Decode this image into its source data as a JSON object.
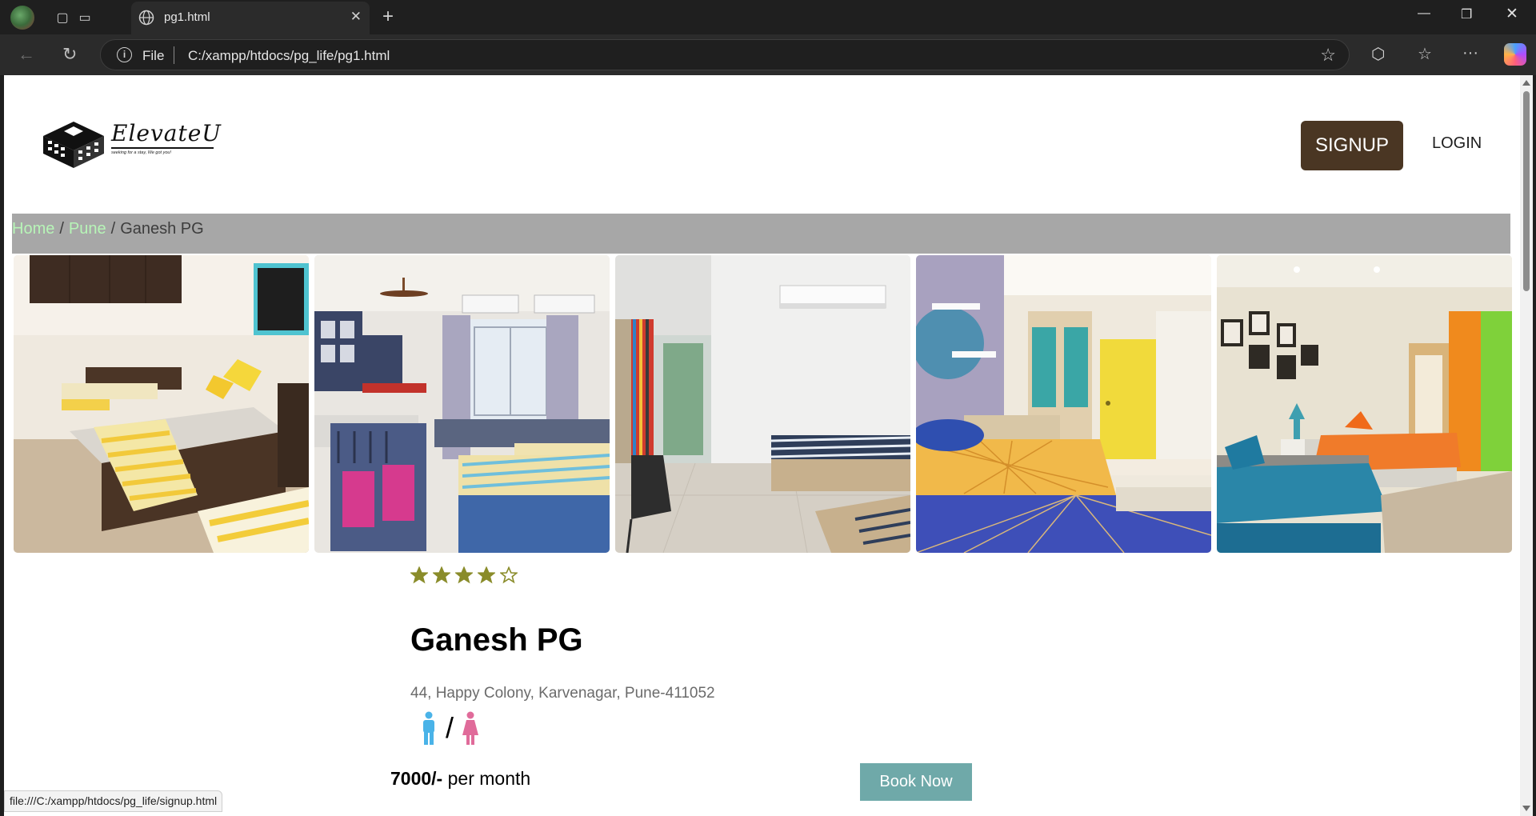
{
  "browser": {
    "tab_title": "pg1.html",
    "address_scheme": "File",
    "address_url": "C:/xampp/htdocs/pg_life/pg1.html",
    "status_url": "file:///C:/xampp/htdocs/pg_life/signup.html"
  },
  "header": {
    "brand": "ElevateU",
    "tagline": "seeking for a stay, We got you!",
    "signup_label": "SIGNUP",
    "login_label": "LOGIN"
  },
  "breadcrumb": {
    "home": "Home",
    "city": "Pune",
    "current": "Ganesh PG",
    "separator": "/"
  },
  "property": {
    "rating": 4,
    "rating_max": 5,
    "name": "Ganesh PG",
    "address": "44, Happy Colony, Karvenagar, Pune-411052",
    "gender_separator": "/",
    "rent_amount": "7000/-",
    "rent_period": "per month",
    "book_label": "Book Now"
  },
  "colors": {
    "signup_bg": "#4a3623",
    "breadcrumb_bg": "#a7a7a7",
    "breadcrumb_link": "#b7f5b7",
    "star": "#8a8c2a",
    "book_bg": "#6fa9a9",
    "male_icon": "#4ab3e8",
    "female_icon": "#e06b9a"
  },
  "icons": {
    "gender_male": "male-icon",
    "gender_female": "female-icon"
  },
  "gallery": {
    "photos": [
      "room-photo-1",
      "room-photo-2",
      "room-photo-3",
      "room-photo-4",
      "room-photo-5"
    ]
  }
}
